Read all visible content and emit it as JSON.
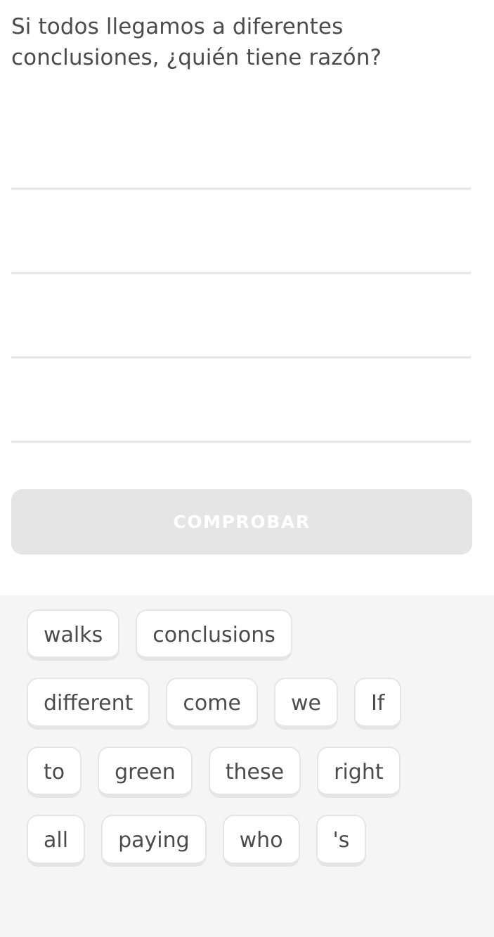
{
  "exercise": {
    "type": "word-bank-translate",
    "prompt": "Si todos llegamos a diferentes conclusiones, ¿quién tiene razón?",
    "answer_lines": [
      {
        "index": 1,
        "tokens": []
      },
      {
        "index": 2,
        "tokens": []
      },
      {
        "index": 3,
        "tokens": []
      },
      {
        "index": 4,
        "tokens": []
      }
    ],
    "line_count": 4
  },
  "check_button": {
    "label": "COMPROBAR",
    "state": "disabled",
    "background": "#e5e5e5",
    "text_color": "#ffffff"
  },
  "word_bank": {
    "background": "#f5f5f5",
    "tile_background": "#ffffff",
    "tile_border": "#e5e5e5",
    "tile_text_color": "#4b4b4b",
    "rows": [
      {
        "index": 1,
        "tiles": [
          {
            "label": "walks",
            "used": false
          },
          {
            "label": "conclusions",
            "used": false
          }
        ]
      },
      {
        "index": 2,
        "tiles": [
          {
            "label": "different",
            "used": false
          },
          {
            "label": "come",
            "used": false
          },
          {
            "label": "we",
            "used": false
          },
          {
            "label": "If",
            "used": false
          }
        ]
      },
      {
        "index": 3,
        "tiles": [
          {
            "label": "to",
            "used": false
          },
          {
            "label": "green",
            "used": false
          },
          {
            "label": "these",
            "used": false
          },
          {
            "label": "right",
            "used": false
          }
        ]
      },
      {
        "index": 4,
        "tiles": [
          {
            "label": "all",
            "used": false
          },
          {
            "label": "paying",
            "used": false
          },
          {
            "label": "who",
            "used": false
          },
          {
            "label": "'s",
            "used": false
          }
        ]
      }
    ]
  },
  "theme": {
    "page_background": "#ffffff",
    "text_primary": "#4b4b4b",
    "rule_line": "#e5e5e5"
  }
}
